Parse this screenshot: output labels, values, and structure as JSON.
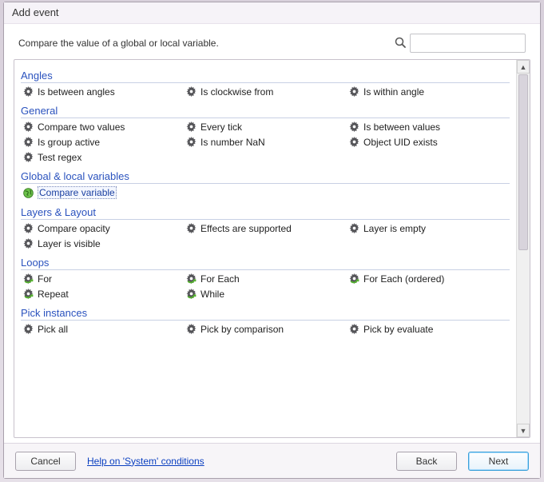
{
  "title": "Add event",
  "description": "Compare the value of a global or local variable.",
  "search": {
    "value": ""
  },
  "categories": [
    {
      "name": "Angles",
      "items": [
        {
          "label": "Is between angles",
          "icon": "gear"
        },
        {
          "label": "Is clockwise from",
          "icon": "gear"
        },
        {
          "label": "Is within angle",
          "icon": "gear"
        }
      ]
    },
    {
      "name": "General",
      "items": [
        {
          "label": "Compare two values",
          "icon": "gear"
        },
        {
          "label": "Every tick",
          "icon": "gear"
        },
        {
          "label": "Is between values",
          "icon": "gear"
        },
        {
          "label": "Is group active",
          "icon": "gear"
        },
        {
          "label": "Is number NaN",
          "icon": "gear"
        },
        {
          "label": "Object UID exists",
          "icon": "gear"
        },
        {
          "label": "Test regex",
          "icon": "gear"
        }
      ]
    },
    {
      "name": "Global & local variables",
      "items": [
        {
          "label": "Compare variable",
          "icon": "globe",
          "selected": true
        }
      ]
    },
    {
      "name": "Layers & Layout",
      "items": [
        {
          "label": "Compare opacity",
          "icon": "gear"
        },
        {
          "label": "Effects are supported",
          "icon": "gear"
        },
        {
          "label": "Layer is empty",
          "icon": "gear"
        },
        {
          "label": "Layer is visible",
          "icon": "gear"
        }
      ]
    },
    {
      "name": "Loops",
      "items": [
        {
          "label": "For",
          "icon": "loop"
        },
        {
          "label": "For Each",
          "icon": "loop"
        },
        {
          "label": "For Each (ordered)",
          "icon": "loop"
        },
        {
          "label": "Repeat",
          "icon": "loop"
        },
        {
          "label": "While",
          "icon": "loop"
        }
      ]
    },
    {
      "name": "Pick instances",
      "cutoff": true,
      "items": [
        {
          "label": "Pick all",
          "icon": "gear"
        },
        {
          "label": "Pick by comparison",
          "icon": "gear"
        },
        {
          "label": "Pick by evaluate",
          "icon": "gear"
        }
      ]
    }
  ],
  "footer": {
    "cancel": "Cancel",
    "help": "Help on 'System' conditions",
    "back": "Back",
    "next": "Next"
  }
}
